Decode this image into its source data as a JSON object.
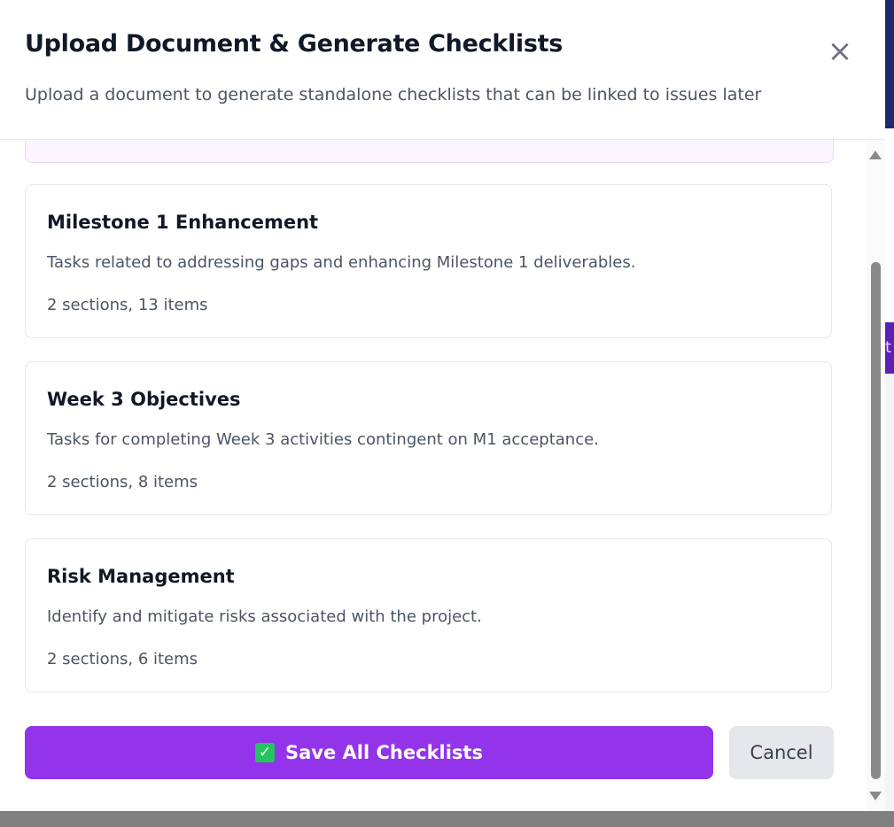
{
  "dialog": {
    "title": "Upload Document & Generate Checklists",
    "subtitle": "Upload a document to generate standalone checklists that can be linked to issues later",
    "close_icon": "×"
  },
  "checklists": [
    {
      "title": "Milestone 1 Enhancement",
      "description": "Tasks related to addressing gaps and enhancing Milestone 1 deliverables.",
      "meta": "2 sections, 13 items"
    },
    {
      "title": "Week 3 Objectives",
      "description": "Tasks for completing Week 3 activities contingent on M1 acceptance.",
      "meta": "2 sections, 8 items"
    },
    {
      "title": "Risk Management",
      "description": "Identify and mitigate risks associated with the project.",
      "meta": "2 sections, 6 items"
    }
  ],
  "actions": {
    "save_icon": "✓",
    "save_label": "Save All Checklists",
    "cancel_label": "Cancel"
  },
  "background": {
    "partial_text": "t"
  },
  "colors": {
    "primary": "#9333ea",
    "cancel_bg": "#e5e7eb",
    "check": "#22c55e"
  }
}
